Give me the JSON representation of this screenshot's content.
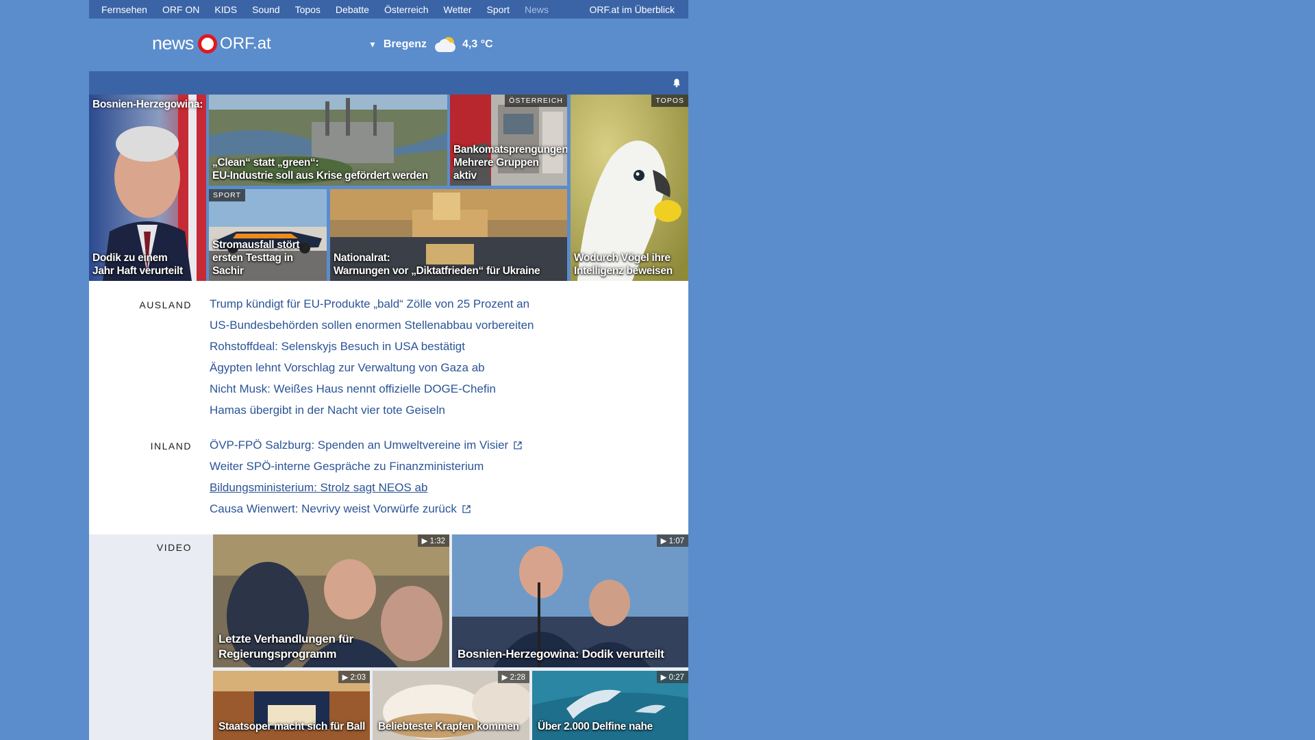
{
  "nav": {
    "items": [
      "Fernsehen",
      "ORF ON",
      "KIDS",
      "Sound",
      "Topos",
      "Debatte",
      "Österreich",
      "Wetter",
      "Sport",
      "News"
    ],
    "overview": "ORF.at im Überblick"
  },
  "logo": {
    "news": "news",
    "orf": "ORF.at"
  },
  "weather": {
    "location": "Bregenz",
    "temperature": "4,3 °C",
    "icon": "partly-cloudy-icon"
  },
  "subbar": {
    "bell_icon": "bell-icon"
  },
  "top_stories": {
    "bosnia": {
      "kicker": "Bosnien-Herzegowina:",
      "line1": "Dodik zu einem",
      "line2": "Jahr Haft verurteilt"
    },
    "clean": {
      "line1": "„Clean“ statt „green“:",
      "line2": "EU-Industrie soll aus Krise gefördert werden"
    },
    "atm": {
      "tag": "ÖSTERREICH",
      "line1": "Bankomatsprengungen:",
      "line2": "Mehrere Gruppen aktiv"
    },
    "birds": {
      "tag": "TOPOS",
      "line1": "Wodurch Vögel ihre",
      "line2": "Intelligenz beweisen"
    },
    "f1": {
      "tag": "SPORT",
      "line1": "Stromausfall stört",
      "line2": "ersten Testtag in Sachir"
    },
    "parliament": {
      "line1": "Nationalrat:",
      "line2": "Warnungen vor „Diktatfrieden“ für Ukraine"
    }
  },
  "sections": {
    "ausland": {
      "label": "AUSLAND",
      "headlines": [
        "Trump kündigt für EU-Produkte „bald“ Zölle von 25 Prozent an",
        "US-Bundesbehörden sollen enormen Stellenabbau vorbereiten",
        "Rohstoffdeal: Selenskyjs Besuch in USA bestätigt",
        "Ägypten lehnt Vorschlag zur Verwaltung von Gaza ab",
        "Nicht Musk: Weißes Haus nennt offizielle DOGE-Chefin",
        "Hamas übergibt in der Nacht vier tote Geiseln"
      ]
    },
    "inland": {
      "label": "INLAND",
      "headlines": [
        "ÖVP-FPÖ Salzburg: Spenden an Umweltvereine im Visier",
        "Weiter SPÖ-interne Gespräche zu Finanzministerium",
        "Bildungsministerium: Strolz sagt NEOS ab",
        "Causa Wienwert: Nevrivy weist Vorwürfe zurück"
      ]
    },
    "video": {
      "label": "VIDEO",
      "items": [
        {
          "duration": "1:32",
          "line1": "Letzte Verhandlungen für",
          "line2": "Regierungsprogramm"
        },
        {
          "duration": "1:07",
          "line1": "Bosnien-Herzegowina: Dodik verurteilt",
          "line2": ""
        },
        {
          "duration": "2:03",
          "line1": "Staatsoper macht sich für Ball",
          "line2": ""
        },
        {
          "duration": "2:28",
          "line1": "Beliebteste Krapfen kommen",
          "line2": ""
        },
        {
          "duration": "0:27",
          "line1": "Über 2.000 Delfine nahe",
          "line2": ""
        }
      ]
    }
  },
  "colors": {
    "background": "#5b8ccc",
    "bar": "#3a64a6",
    "link": "#2b5497",
    "brand_red": "#e3161b"
  }
}
